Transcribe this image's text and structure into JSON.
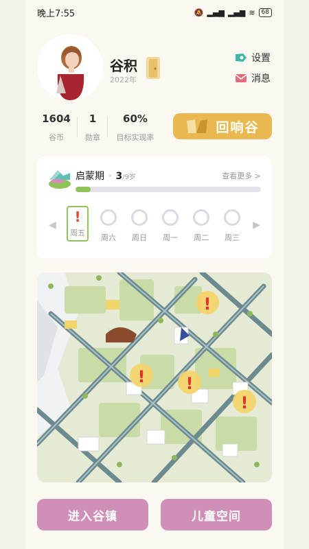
{
  "status_bar": {
    "time": "晚上7:55",
    "battery": "68"
  },
  "profile": {
    "name": "谷积",
    "year": "2022年"
  },
  "links": {
    "settings": "设置",
    "messages": "消息"
  },
  "stats": [
    {
      "value": "1604",
      "label": "谷币"
    },
    {
      "value": "1",
      "label": "勋章"
    },
    {
      "value": "60%",
      "label": "目标实现率"
    }
  ],
  "echo_button": "回响谷",
  "stage": {
    "title": "启蒙期",
    "age": "3",
    "age_total": "/9岁",
    "more": "查看更多 >",
    "progress": 0.08
  },
  "week": {
    "alert_mark": "!",
    "days": [
      "周五",
      "周六",
      "周日",
      "周一",
      "周二",
      "周三"
    ]
  },
  "buttons": {
    "enter_town": "进入谷镇",
    "kids_space": "儿童空间"
  },
  "colors": {
    "accent_gold": "#e9b84f",
    "progress_green": "#8fc45b",
    "button_pink": "#cf8fb7"
  }
}
